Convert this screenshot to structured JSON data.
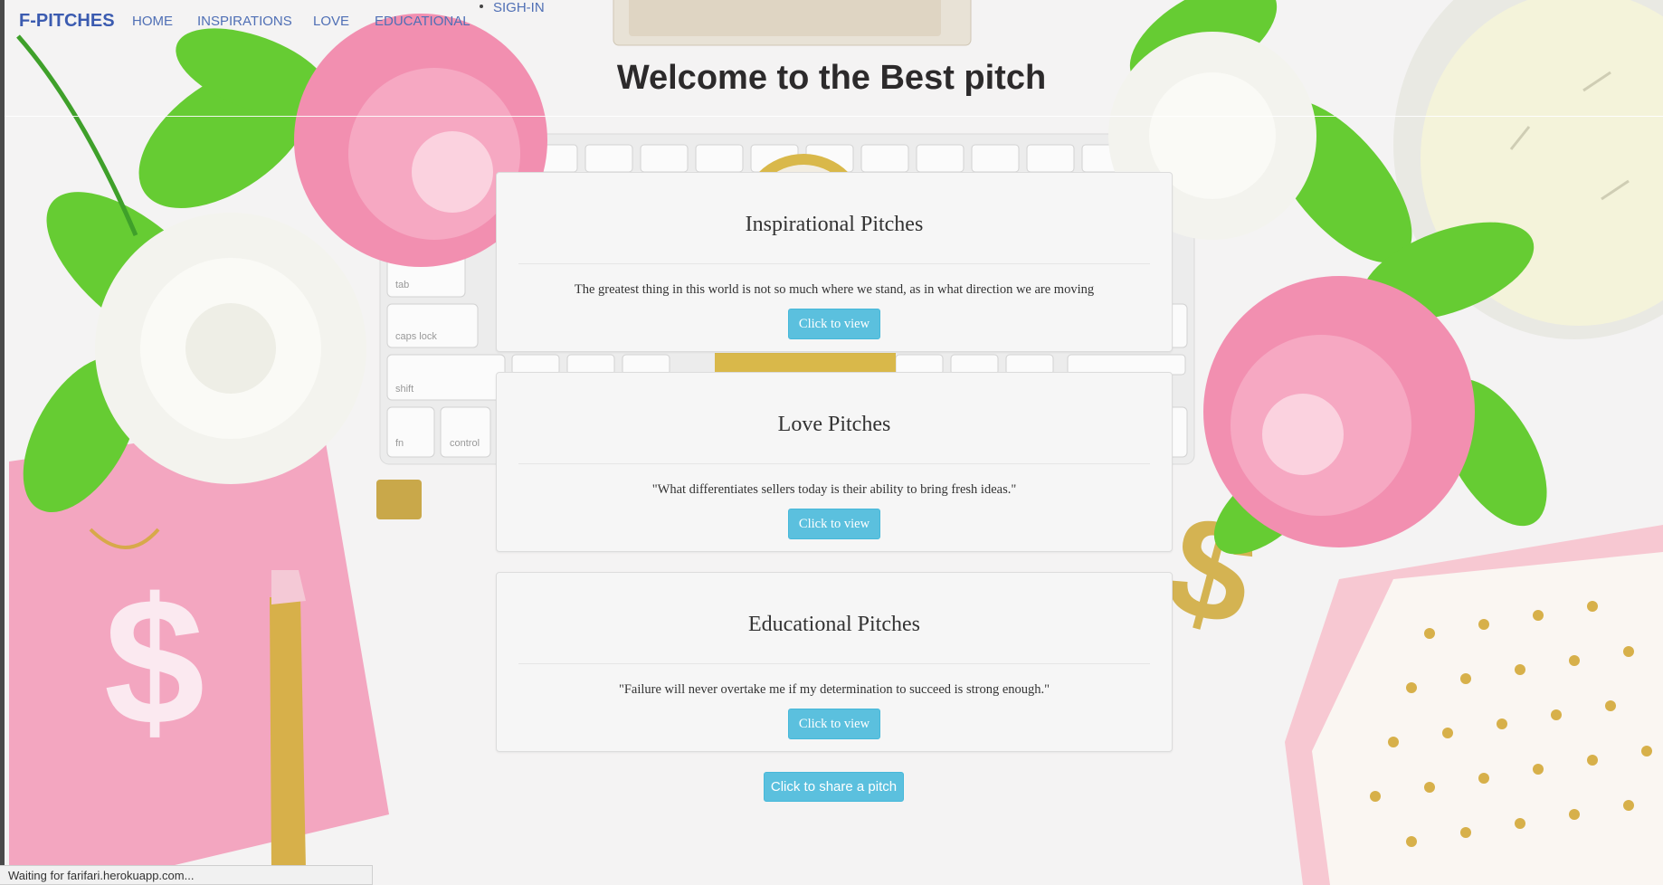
{
  "navbar": {
    "brand": "F-PITCHES",
    "links": [
      "HOME",
      "INSPIRATIONS",
      "LOVE",
      "EDUCATIONAL",
      "SIGH-IN"
    ]
  },
  "page_title": "Welcome to the Best pitch",
  "panels": [
    {
      "title": "Inspirational Pitches",
      "quote": "The greatest thing in this world is not so much where we stand, as in what direction we are moving",
      "button": "Click to view"
    },
    {
      "title": "Love Pitches",
      "quote": "\"What differentiates sellers today is their ability to bring fresh ideas.\"",
      "button": "Click to view"
    },
    {
      "title": "Educational Pitches",
      "quote": "\"Failure will never overtake me if my determination to succeed is strong enough.\"",
      "button": "Click to view"
    }
  ],
  "share_button": "Click to share a pitch",
  "status_bar": "Waiting for farifari.herokuapp.com...",
  "colors": {
    "brand": "#3b5bb0",
    "nav_link": "#4f6fb5",
    "button": "#5bc0de",
    "panel_bg": "#f6f6f6",
    "peony_pink": "#f28fb0",
    "leaf_green": "#6fcf3a"
  },
  "background_icons": [
    "keyboard-image",
    "peony-flowers-image",
    "candle-image",
    "dollar-sign-image",
    "gold-pen-image",
    "binder-clip-image",
    "gift-box-image"
  ]
}
